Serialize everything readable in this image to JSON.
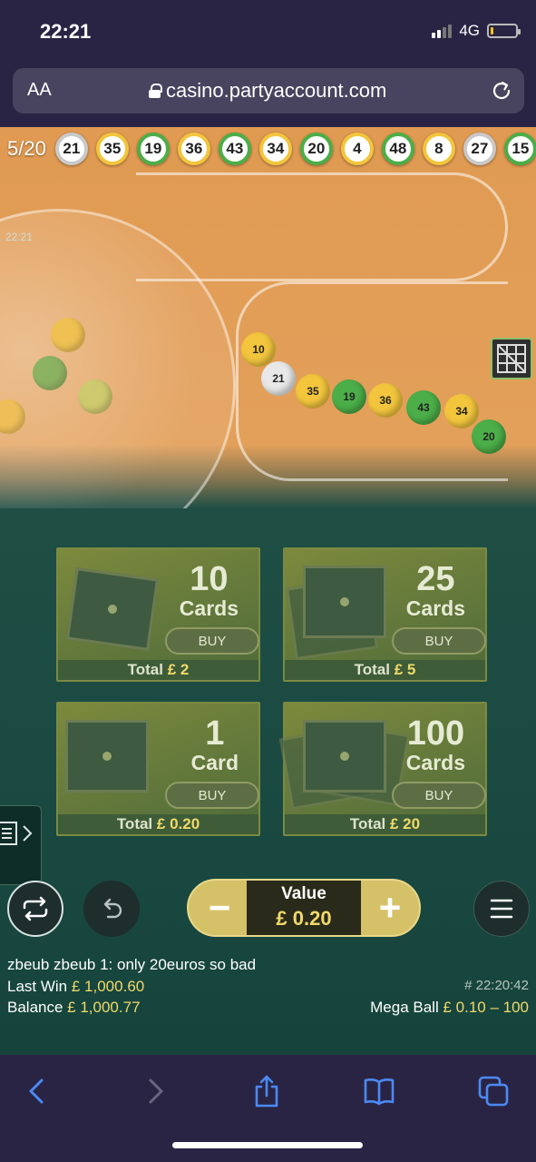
{
  "status": {
    "time": "22:21",
    "network": "4G"
  },
  "browser": {
    "text_size_label": "AA",
    "url": "casino.partyaccount.com"
  },
  "draw": {
    "counter": "5/20",
    "balls": [
      {
        "n": "21",
        "color": "#c9c9c9"
      },
      {
        "n": "35",
        "color": "#f2c53d"
      },
      {
        "n": "19",
        "color": "#4cae48"
      },
      {
        "n": "36",
        "color": "#f2c53d"
      },
      {
        "n": "43",
        "color": "#4cae48"
      },
      {
        "n": "34",
        "color": "#f2c53d"
      },
      {
        "n": "20",
        "color": "#4cae48"
      },
      {
        "n": "4",
        "color": "#f2c53d"
      },
      {
        "n": "48",
        "color": "#4cae48"
      },
      {
        "n": "8",
        "color": "#f2c53d"
      },
      {
        "n": "27",
        "color": "#c9c9c9"
      },
      {
        "n": "15",
        "color": "#4cae48"
      }
    ]
  },
  "cards": [
    {
      "count": "10",
      "word": "Cards",
      "buy": "BUY",
      "total_label": "Total",
      "total": "£ 2"
    },
    {
      "count": "25",
      "word": "Cards",
      "buy": "BUY",
      "total_label": "Total",
      "total": "£ 5"
    },
    {
      "count": "1",
      "word": "Card",
      "buy": "BUY",
      "total_label": "Total",
      "total": "£ 0.20"
    },
    {
      "count": "100",
      "word": "Cards",
      "buy": "BUY",
      "total_label": "Total",
      "total": "£ 20"
    }
  ],
  "drawer": {
    "time": "22:21"
  },
  "bet": {
    "label": "Value",
    "amount": "£ 0.20",
    "minus": "−",
    "plus": "+"
  },
  "chat": {
    "message": "zbeub zbeub 1: only 20euros so bad"
  },
  "last_win": {
    "label": "Last Win",
    "amount": "£ 1,000.60"
  },
  "balance": {
    "label": "Balance",
    "amount": "£ 1,000.77"
  },
  "game_ref": "# 22:20:42",
  "game_info": {
    "name": "Mega Ball",
    "range": "£ 0.10 – 100"
  },
  "colors": {
    "accent_gold": "#f0d96a",
    "browser_bg": "#2a2444",
    "link_blue": "#4a8af4"
  }
}
